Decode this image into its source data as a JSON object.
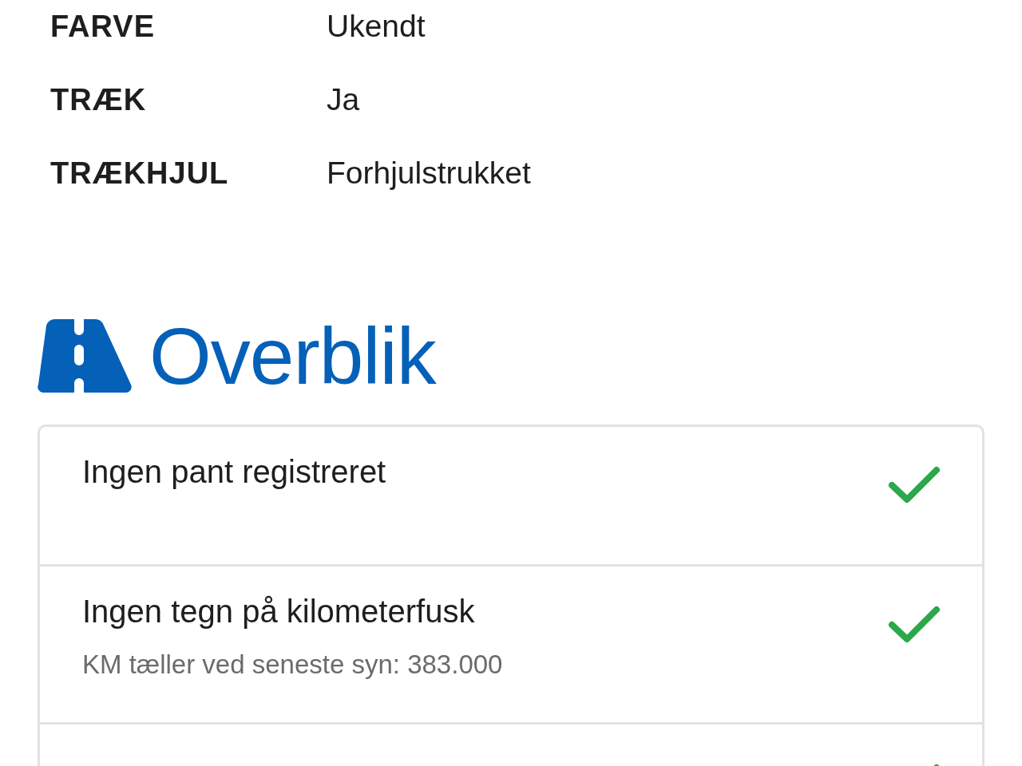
{
  "specs": [
    {
      "label": "FARVE",
      "value": "Ukendt"
    },
    {
      "label": "TRÆK",
      "value": "Ja"
    },
    {
      "label": "TRÆKHJUL",
      "value": "Forhjulstrukket"
    }
  ],
  "overview": {
    "title": "Overblik",
    "items": [
      {
        "title": "Ingen pant registreret",
        "passed": true
      },
      {
        "title": "Ingen tegn på kilometerfusk",
        "detail": "KM tæller ved seneste syn: 383.000",
        "passed": true
      },
      {
        "passed": true
      }
    ]
  }
}
